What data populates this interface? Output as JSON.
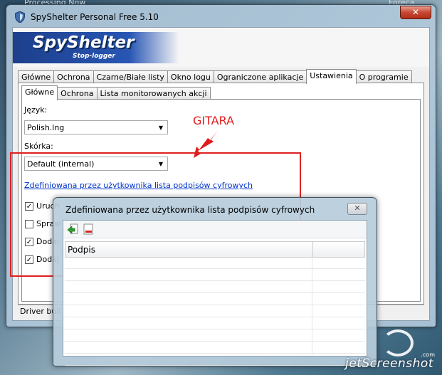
{
  "desktop": {
    "top_text": "Processing Now",
    "top_right_text": "Foreca",
    "watermark": "jetScreenshot",
    "watermark_com": ".com"
  },
  "window": {
    "title": "SpyShelter Personal Free 5.10",
    "close_glyph": "✕",
    "logo_main": "SpyShelter",
    "logo_sub": "Stop-logger",
    "tabs": [
      "Główne",
      "Ochrona",
      "Czarne/Białe listy",
      "Okno logu",
      "Ograniczone aplikacje",
      "Ustawienia",
      "O programie"
    ],
    "active_tab": "Ustawienia",
    "subtabs": [
      "Główne",
      "Ochrona",
      "Lista monitorowanych akcji"
    ],
    "active_subtab": "Główne",
    "language_label": "Język:",
    "language_value": "Polish.lng",
    "skin_label": "Skórka:",
    "skin_value": "Default (internal)",
    "signatures_link": "Zdefiniowana przez użytkownika lista podpisów cyfrowych",
    "checkboxes": [
      {
        "label": "Uruch",
        "checked": true
      },
      {
        "label": "Spraw",
        "checked": false
      },
      {
        "label": "Dodaj",
        "checked": true
      },
      {
        "label": "Dodaj",
        "checked": true
      }
    ],
    "status_text": "Driver buil"
  },
  "dialog": {
    "title": "Zdefiniowana przez użytkownika lista podpisów cyfrowych",
    "close_glyph": "✕",
    "column_header": "Podpis"
  },
  "annotation": {
    "text": "GITARA",
    "color": "#e01b1b"
  },
  "icons": [
    "shield-icon",
    "close-icon",
    "dropdown-arrow-icon",
    "checkbox-check-icon",
    "add-signature-icon",
    "remove-signature-icon",
    "annotation-arrow-icon"
  ]
}
